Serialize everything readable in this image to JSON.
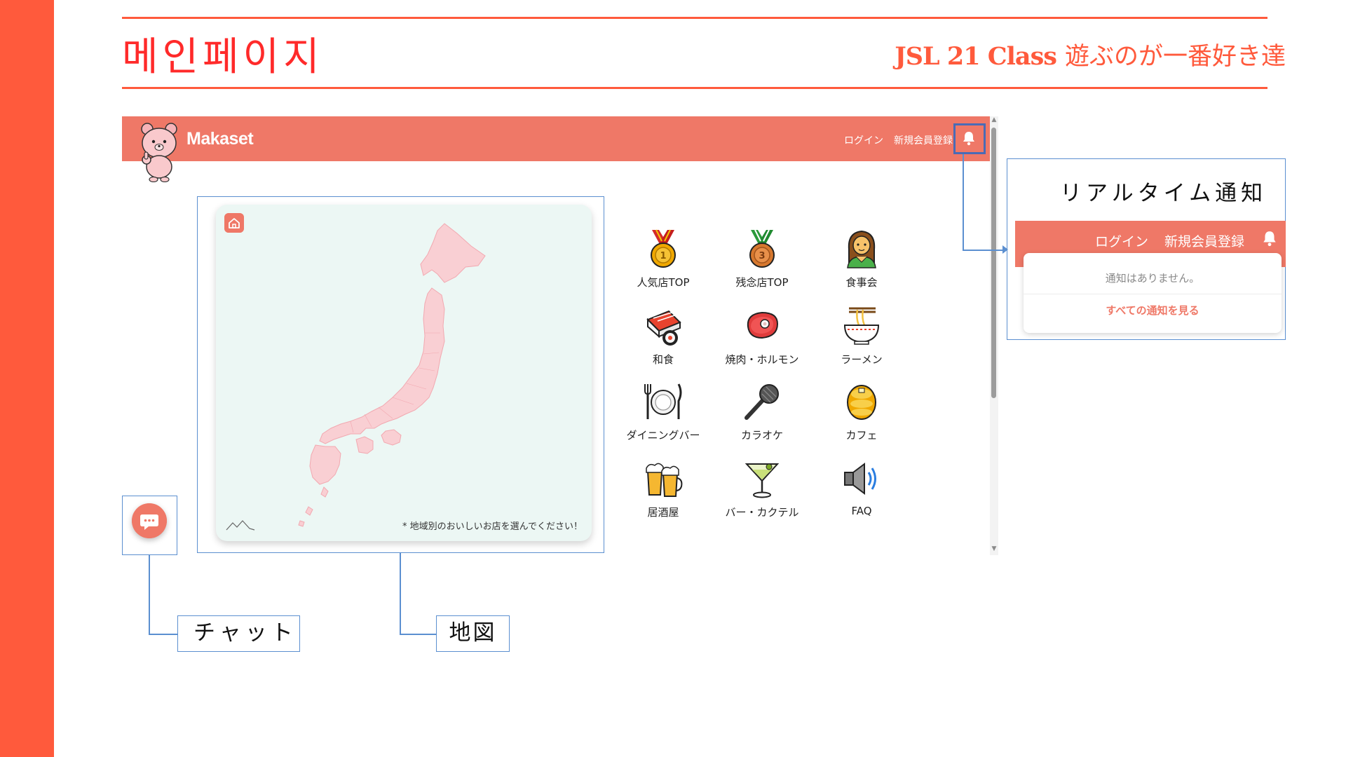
{
  "slide": {
    "title": "메인페이지",
    "subtitle_bold": "JSL 21 Class",
    "subtitle_rest": "遊ぶのが一番好き達"
  },
  "app": {
    "brand": "Makaset",
    "header_links": [
      "ログイン",
      "新規会員登録"
    ],
    "bell_icon": "bell-icon",
    "map_note": "* 地域別のおいしいお店を選んでください！",
    "categories": [
      {
        "label": "人気店TOP",
        "icon": "gold-medal-icon"
      },
      {
        "label": "残念店TOP",
        "icon": "bronze-medal-icon"
      },
      {
        "label": "食事会",
        "icon": "person-icon"
      },
      {
        "label": "和食",
        "icon": "sushi-icon"
      },
      {
        "label": "焼肉・ホルモン",
        "icon": "meat-icon"
      },
      {
        "label": "ラーメン",
        "icon": "ramen-icon"
      },
      {
        "label": "ダイニングバー",
        "icon": "dining-icon"
      },
      {
        "label": "カラオケ",
        "icon": "microphone-icon"
      },
      {
        "label": "カフェ",
        "icon": "pancake-icon"
      },
      {
        "label": "居酒屋",
        "icon": "beer-icon"
      },
      {
        "label": "バー・カクテル",
        "icon": "cocktail-icon"
      },
      {
        "label": "FAQ",
        "icon": "speaker-icon"
      }
    ]
  },
  "callouts": {
    "chat": "チャット",
    "map": "地図",
    "realtime": "リアルタイム通知"
  },
  "notification": {
    "links": [
      "ログイン",
      "新規会員登録"
    ],
    "empty_text": "通知はありません。",
    "view_all": "すべての通知を見る"
  },
  "colors": {
    "accent": "#ff5a3c",
    "header": "#ef7867",
    "frame": "#5b8fd0"
  }
}
